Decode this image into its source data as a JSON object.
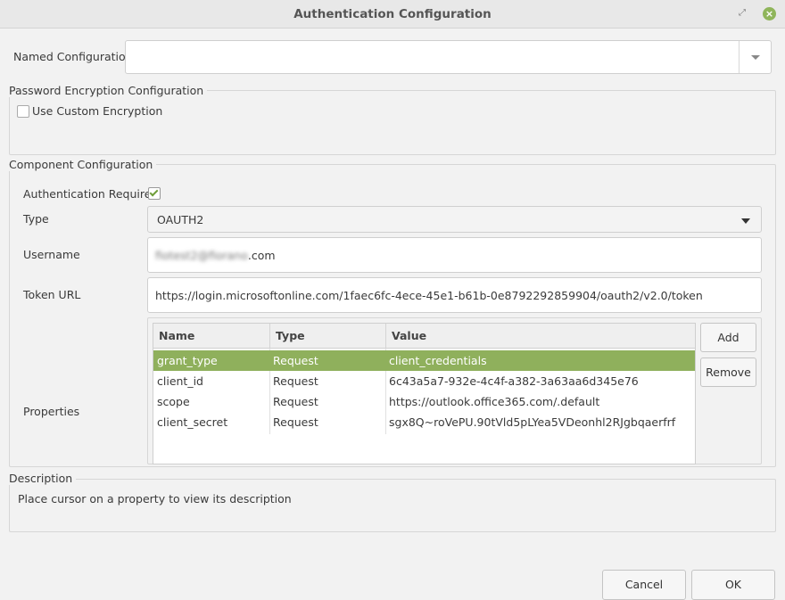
{
  "window": {
    "title": "Authentication Configuration"
  },
  "named_configuration": {
    "label": "Named Configuration",
    "value": ""
  },
  "password_encryption": {
    "title": "Password Encryption Configuration",
    "use_custom_label": "Use Custom Encryption",
    "use_custom_checked": false
  },
  "component": {
    "title": "Component Configuration",
    "auth_required_label": "Authentication Required",
    "auth_required_checked": true,
    "type_label": "Type",
    "type_value": "OAUTH2",
    "username_label": "Username",
    "username_blurred": "fiotest2@fiorano",
    "username_suffix": ".com",
    "token_url_label": "Token URL",
    "token_url_value": "https://login.microsoftonline.com/1faec6fc-4ece-45e1-b61b-0e8792292859904/oauth2/v2.0/token",
    "properties_label": "Properties",
    "table": {
      "columns": [
        "Name",
        "Type",
        "Value"
      ],
      "rows": [
        {
          "name": "grant_type",
          "type": "Request",
          "value": "client_credentials",
          "selected": true
        },
        {
          "name": "client_id",
          "type": "Request",
          "value": "6c43a5a7-932e-4c4f-a382-3a63aa6d345e76",
          "selected": false
        },
        {
          "name": "scope",
          "type": "Request",
          "value": "https://outlook.office365.com/.default",
          "selected": false
        },
        {
          "name": "client_secret",
          "type": "Request",
          "value": "sgx8Q~roVePU.90tVld5pLYea5VDeonhl2RJgbqaerfrf",
          "selected": false
        }
      ]
    },
    "add_label": "Add",
    "remove_label": "Remove"
  },
  "description": {
    "title": "Description",
    "text": "Place cursor on a property to view its description"
  },
  "buttons": {
    "cancel": "Cancel",
    "ok": "OK"
  },
  "colors": {
    "accent": "#8fb05c",
    "close": "#8fb55a"
  }
}
